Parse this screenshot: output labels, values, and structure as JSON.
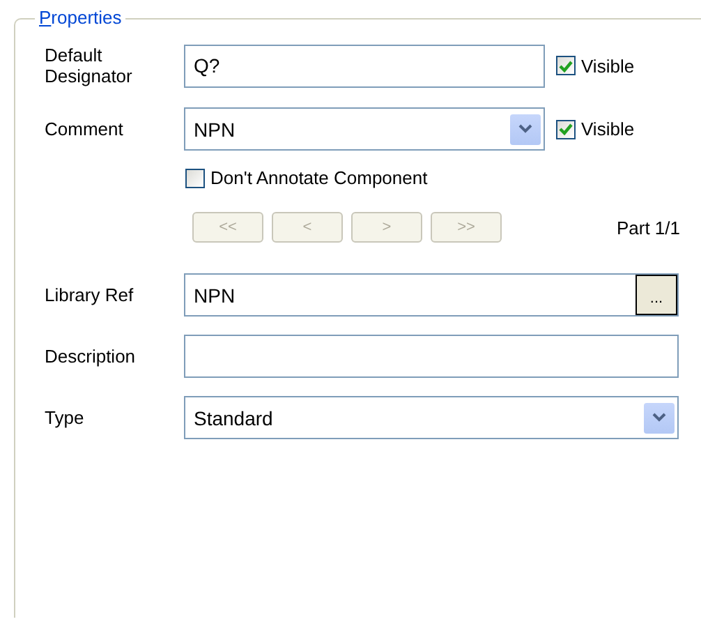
{
  "group": {
    "title": "Properties"
  },
  "designator": {
    "label": "Default Designator",
    "value": "Q?",
    "visible": {
      "label": "Visible",
      "checked": true
    }
  },
  "comment": {
    "label": "Comment",
    "value": "NPN",
    "visible": {
      "label": "Visible",
      "checked": true
    }
  },
  "dont_annotate": {
    "label": "Don't Annotate Component",
    "checked": false
  },
  "part_nav": {
    "buttons": [
      {
        "label": "<<",
        "disabled": true
      },
      {
        "label": "<",
        "disabled": true
      },
      {
        "label": ">",
        "disabled": true
      },
      {
        "label": ">>",
        "disabled": true
      }
    ],
    "part": "Part 1/1"
  },
  "library_ref": {
    "label": "Library Ref",
    "value": "NPN",
    "browse": "..."
  },
  "description": {
    "label": "Description"
  },
  "type": {
    "label": "Type",
    "value": "Standard"
  }
}
